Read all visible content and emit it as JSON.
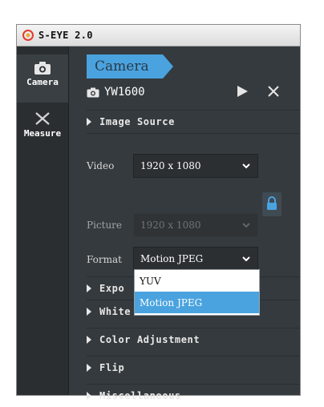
{
  "window": {
    "title": "S-EYE 2.0"
  },
  "rail": {
    "items": [
      {
        "label": "Camera",
        "icon": "camera-icon",
        "active": true
      },
      {
        "label": "Measure",
        "icon": "measure-icon",
        "active": false
      }
    ]
  },
  "panel": {
    "header": "Camera",
    "device": {
      "name": "YW1600"
    },
    "sections": {
      "image_source": "Image Source",
      "exposure": "Expo",
      "white_balance": "White Balance",
      "color_adjustment": "Color Adjustment",
      "flip": "Flip",
      "miscellaneous": "Miscellaneous"
    },
    "fields": {
      "video": {
        "label": "Video",
        "value": "1920 x 1080"
      },
      "picture": {
        "label": "Picture",
        "value": "1920 x 1080",
        "disabled": true
      },
      "format": {
        "label": "Format",
        "value": "Motion JPEG"
      }
    },
    "format_options": [
      "YUV",
      "Motion JPEG"
    ],
    "format_selected_index": 1
  },
  "colors": {
    "accent": "#4aa3df",
    "panel": "#353a3e",
    "rail": "#2a2e31"
  }
}
